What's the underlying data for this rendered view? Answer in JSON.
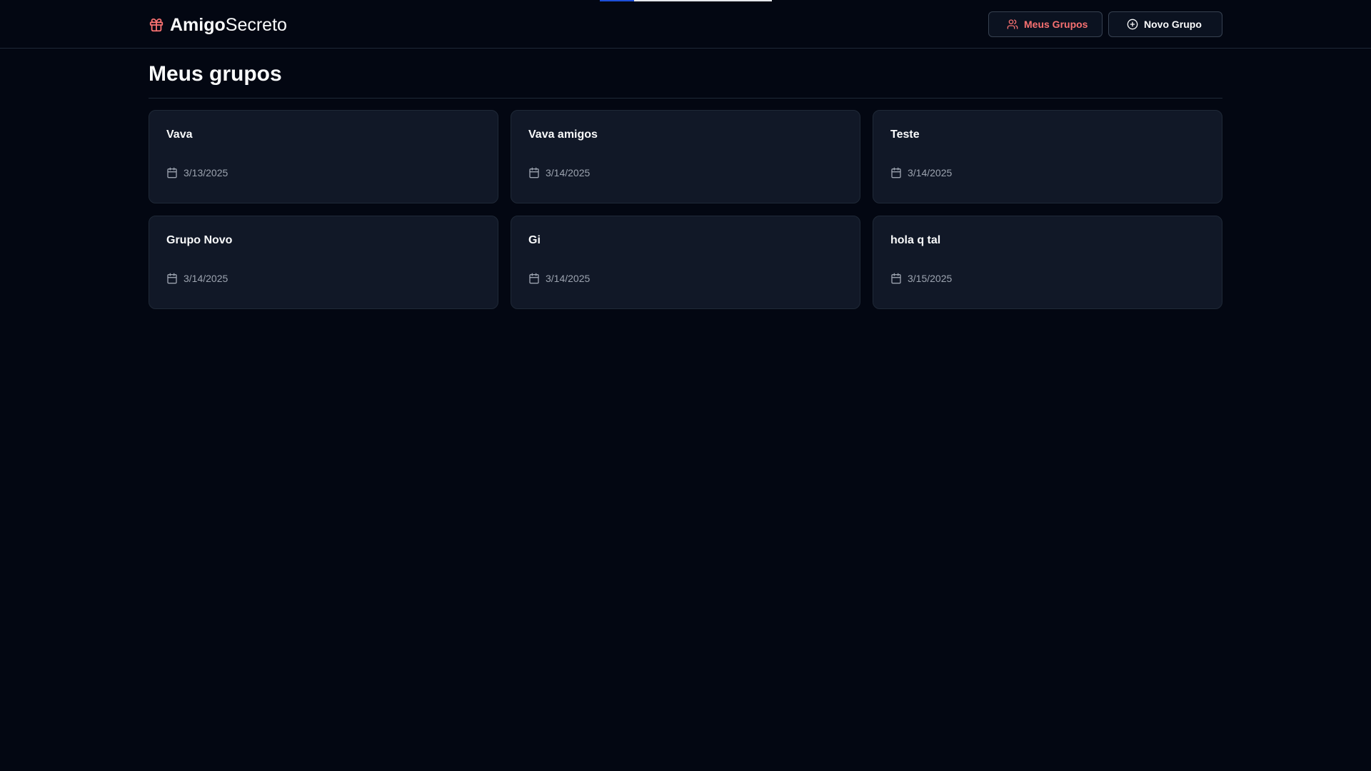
{
  "loading_bar": {
    "progress": 0.2
  },
  "header": {
    "logo_icon": "gift-icon",
    "brand_bold": "Amigo",
    "brand_light": "Secreto",
    "accent_color": "#f87171",
    "nav": {
      "my_groups": {
        "label": "Meus Grupos",
        "icon": "users-icon",
        "active": true
      },
      "new_group": {
        "label": "Novo Grupo",
        "icon": "plus-circle-icon",
        "active": false
      }
    }
  },
  "main": {
    "title": "Meus grupos",
    "groups": [
      {
        "name": "Vava",
        "date": "3/13/2025",
        "icon": "calendar-icon"
      },
      {
        "name": "Vava amigos",
        "date": "3/14/2025",
        "icon": "calendar-icon"
      },
      {
        "name": "Teste",
        "date": "3/14/2025",
        "icon": "calendar-icon"
      },
      {
        "name": "Grupo Novo",
        "date": "3/14/2025",
        "icon": "calendar-icon"
      },
      {
        "name": "Gi",
        "date": "3/14/2025",
        "icon": "calendar-icon"
      },
      {
        "name": "hola q tal",
        "date": "3/15/2025",
        "icon": "calendar-icon"
      }
    ]
  }
}
